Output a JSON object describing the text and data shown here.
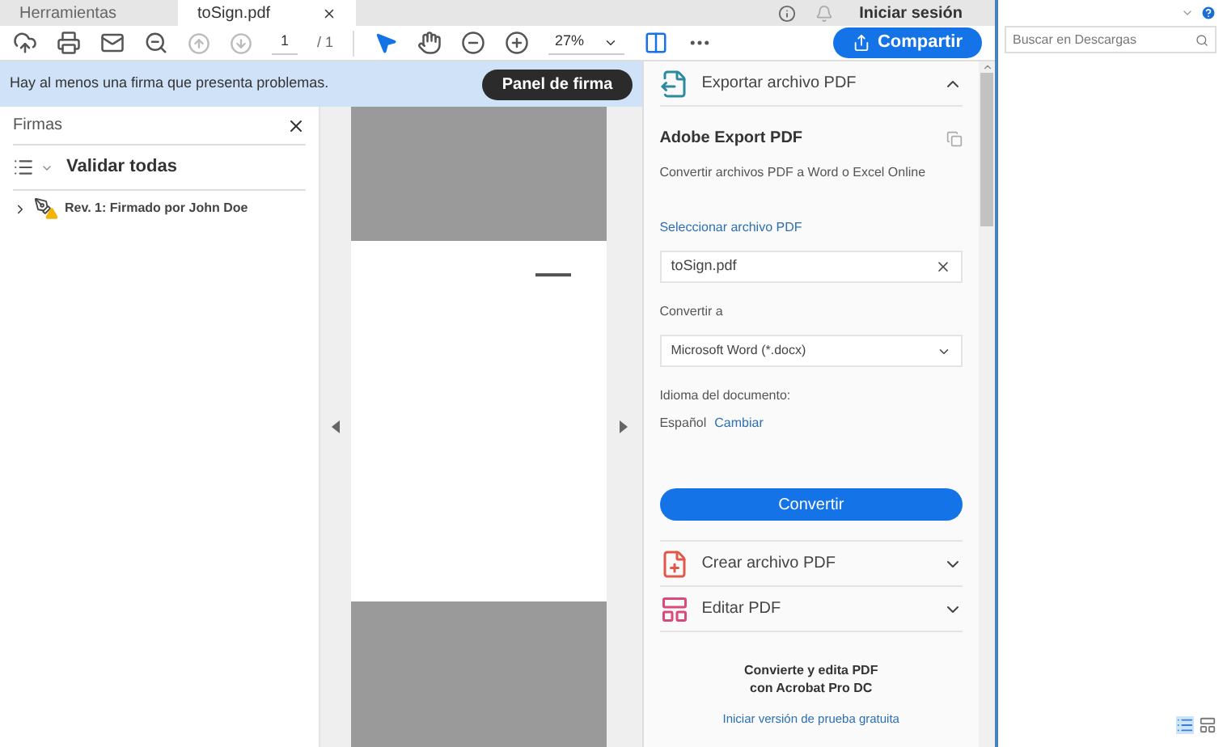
{
  "tabs": [
    {
      "label": "Herramientas",
      "selected": false
    },
    {
      "label": "toSign.pdf",
      "selected": true
    }
  ],
  "account": {
    "label": "Iniciar sesión"
  },
  "toolbar": {
    "page": "1",
    "page_total": "/ 1",
    "zoom": "27%",
    "share": "Compartir"
  },
  "banner": {
    "message": "Hay al menos una firma que presenta problemas.",
    "button": "Panel de firma"
  },
  "signatures": {
    "title": "Firmas",
    "validate_all": "Validar todas",
    "items": [
      {
        "label": "Rev. 1: Firmado por John Doe",
        "expanded": false,
        "warning": true
      }
    ]
  },
  "tools": [
    {
      "label": "Exportar archivo PDF",
      "kind": "export",
      "expanded": true
    },
    {
      "label": "Crear archivo PDF",
      "kind": "create",
      "expanded": false
    },
    {
      "label": "Editar PDF",
      "kind": "edit",
      "expanded": false
    }
  ],
  "export": {
    "heading": "Adobe Export PDF",
    "description": "Convertir archivos PDF a Word o Excel Online",
    "select_label": "Seleccionar archivo PDF",
    "file": "toSign.pdf",
    "convert_label": "Convertir a",
    "format": "Microsoft Word (*.docx)",
    "language_label": "Idioma del documento:",
    "language": "Español",
    "change": "Cambiar",
    "button": "Convertir"
  },
  "promo": {
    "text": "Convierte y edita PDF con Acrobat Pro DC",
    "link": "Iniciar versión de prueba gratuita"
  },
  "explorer": {
    "search_placeholder": "Buscar en Descargas"
  }
}
